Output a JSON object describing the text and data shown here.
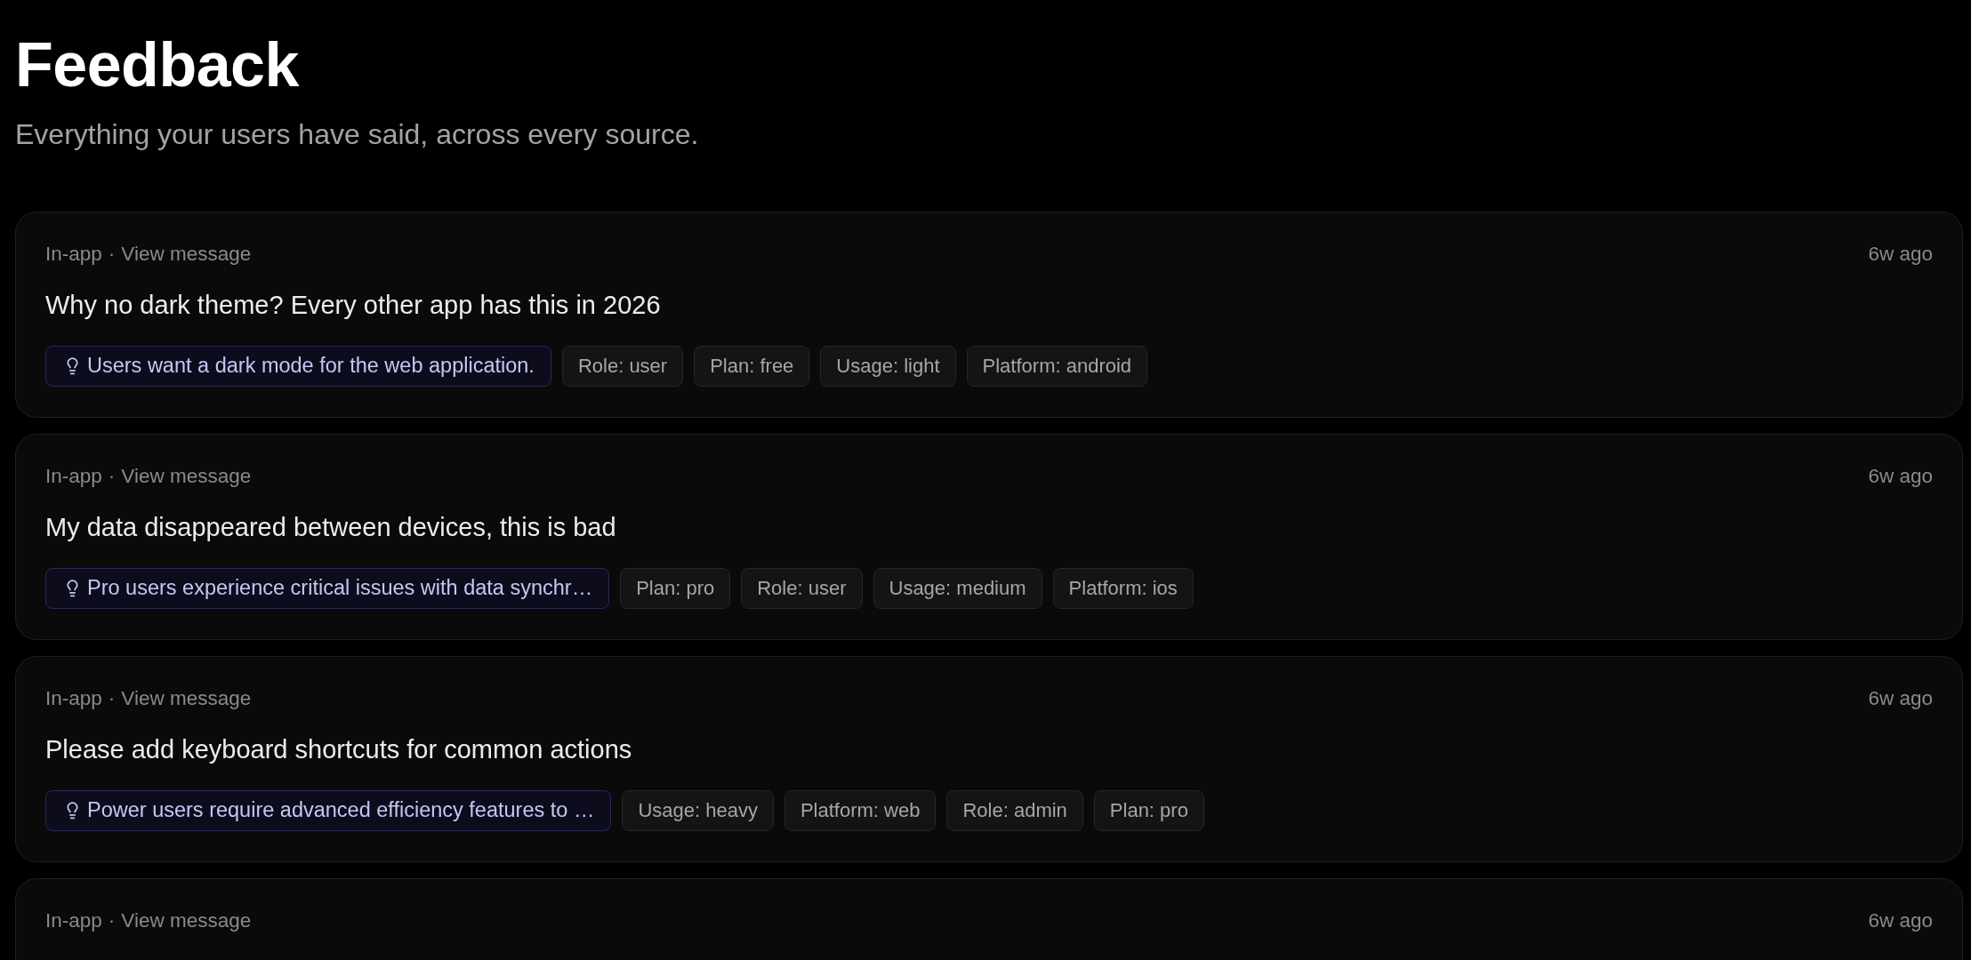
{
  "page": {
    "title": "Feedback",
    "subtitle": "Everything your users have said, across every source."
  },
  "feedback": [
    {
      "source": "In-app",
      "separator": "·",
      "link": "View message",
      "time": "6w ago",
      "message": "Why no dark theme? Every other app has this in 2026",
      "chips": [
        {
          "kind": "insight",
          "label": "Users want a dark mode for the web application."
        },
        {
          "kind": "tag",
          "label": "Role: user"
        },
        {
          "kind": "tag",
          "label": "Plan: free"
        },
        {
          "kind": "tag",
          "label": "Usage: light"
        },
        {
          "kind": "tag",
          "label": "Platform: android"
        }
      ]
    },
    {
      "source": "In-app",
      "separator": "·",
      "link": "View message",
      "time": "6w ago",
      "message": "My data disappeared between devices, this is bad",
      "chips": [
        {
          "kind": "insight",
          "label": "Pro users experience critical issues with data synchr…"
        },
        {
          "kind": "tag",
          "label": "Plan: pro"
        },
        {
          "kind": "tag",
          "label": "Role: user"
        },
        {
          "kind": "tag",
          "label": "Usage: medium"
        },
        {
          "kind": "tag",
          "label": "Platform: ios"
        }
      ]
    },
    {
      "source": "In-app",
      "separator": "·",
      "link": "View message",
      "time": "6w ago",
      "message": "Please add keyboard shortcuts for common actions",
      "chips": [
        {
          "kind": "insight",
          "label": "Power users require advanced efficiency features to …"
        },
        {
          "kind": "tag",
          "label": "Usage: heavy"
        },
        {
          "kind": "tag",
          "label": "Platform: web"
        },
        {
          "kind": "tag",
          "label": "Role: admin"
        },
        {
          "kind": "tag",
          "label": "Plan: pro"
        }
      ]
    },
    {
      "source": "In-app",
      "separator": "·",
      "link": "View message",
      "time": "6w ago"
    }
  ]
}
